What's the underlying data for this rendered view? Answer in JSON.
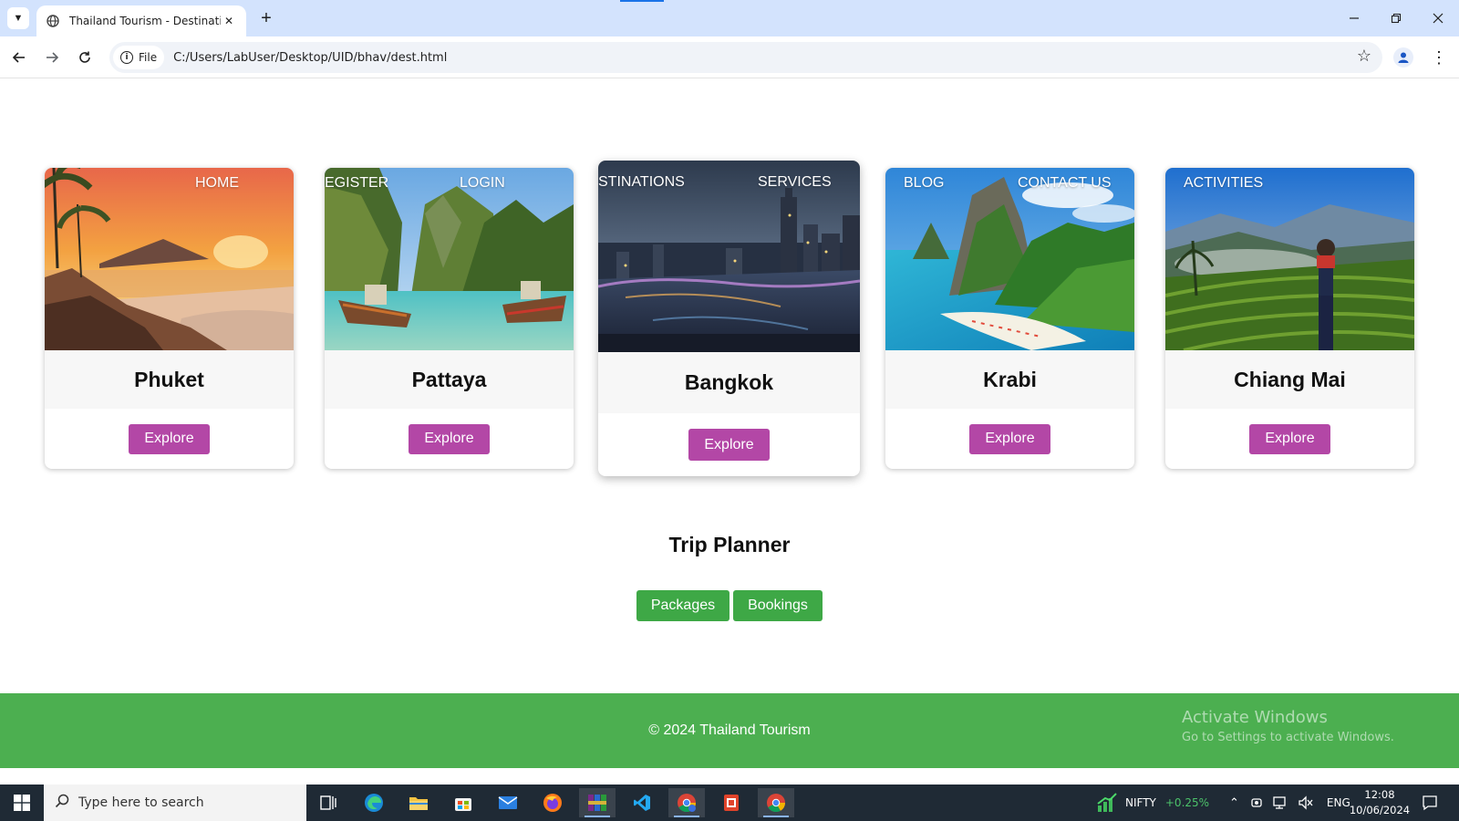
{
  "browser": {
    "tab_title": "Thailand Tourism - Destinations",
    "site_label": "File",
    "url": "C:/Users/LabUser/Desktop/UID/bhav/dest.html"
  },
  "nav": {
    "home": "HOME",
    "register": "EGISTER",
    "login": "LOGIN",
    "destinations": "STINATIONS",
    "services": "SERVICES",
    "blog": "BLOG",
    "contact": "CONTACT US",
    "activities": "ACTIVITIES"
  },
  "destinations": [
    {
      "name": "Phuket",
      "button": "Explore"
    },
    {
      "name": "Pattaya",
      "button": "Explore"
    },
    {
      "name": "Bangkok",
      "button": "Explore"
    },
    {
      "name": "Krabi",
      "button": "Explore"
    },
    {
      "name": "Chiang Mai",
      "button": "Explore"
    }
  ],
  "trip_planner": {
    "title": "Trip Planner",
    "packages": "Packages",
    "bookings": "Bookings"
  },
  "footer": {
    "text": "© 2024 Thailand Tourism"
  },
  "watermark": {
    "line1": "Activate Windows",
    "line2": "Go to Settings to activate Windows."
  },
  "taskbar": {
    "search_placeholder": "Type here to search",
    "stock_name": "NIFTY",
    "stock_change": "+0.25%",
    "language": "ENG",
    "time": "12:08",
    "date": "10/06/2024"
  },
  "colors": {
    "explore_button": "#b347a6",
    "green_button": "#3ea846",
    "footer_bg": "#4caf50",
    "tabbar_bg": "#d3e3fd",
    "stock_green": "#4cc26a"
  }
}
